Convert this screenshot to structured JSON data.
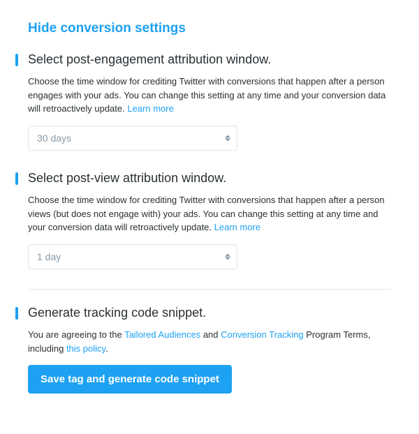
{
  "main_title": "Hide conversion settings",
  "sections": {
    "postEngagement": {
      "title": "Select post-engagement attribution window.",
      "desc_pre": "Choose the time window for crediting Twitter with conversions that happen after a person engages with your ads. You can change this setting at any time and your conversion data will retroactively update. ",
      "learn_more": "Learn more",
      "select_value": "30 days"
    },
    "postView": {
      "title": "Select post-view attribution window.",
      "desc_pre": "Choose the time window for crediting Twitter with conversions that happen after a person views (but does not engage with) your ads. You can change this setting at any time and your conversion data will retroactively update. ",
      "learn_more": "Learn more",
      "select_value": "1 day"
    },
    "generate": {
      "title": "Generate tracking code snippet.",
      "desc_pre": "You are agreeing to the ",
      "link1": "Tailored Audiences",
      "desc_mid1": " and ",
      "link2": "Conversion Tracking",
      "desc_mid2": " Program Terms, including ",
      "link3": "this policy",
      "desc_post": ".",
      "button_label": "Save tag and generate code snippet"
    }
  }
}
